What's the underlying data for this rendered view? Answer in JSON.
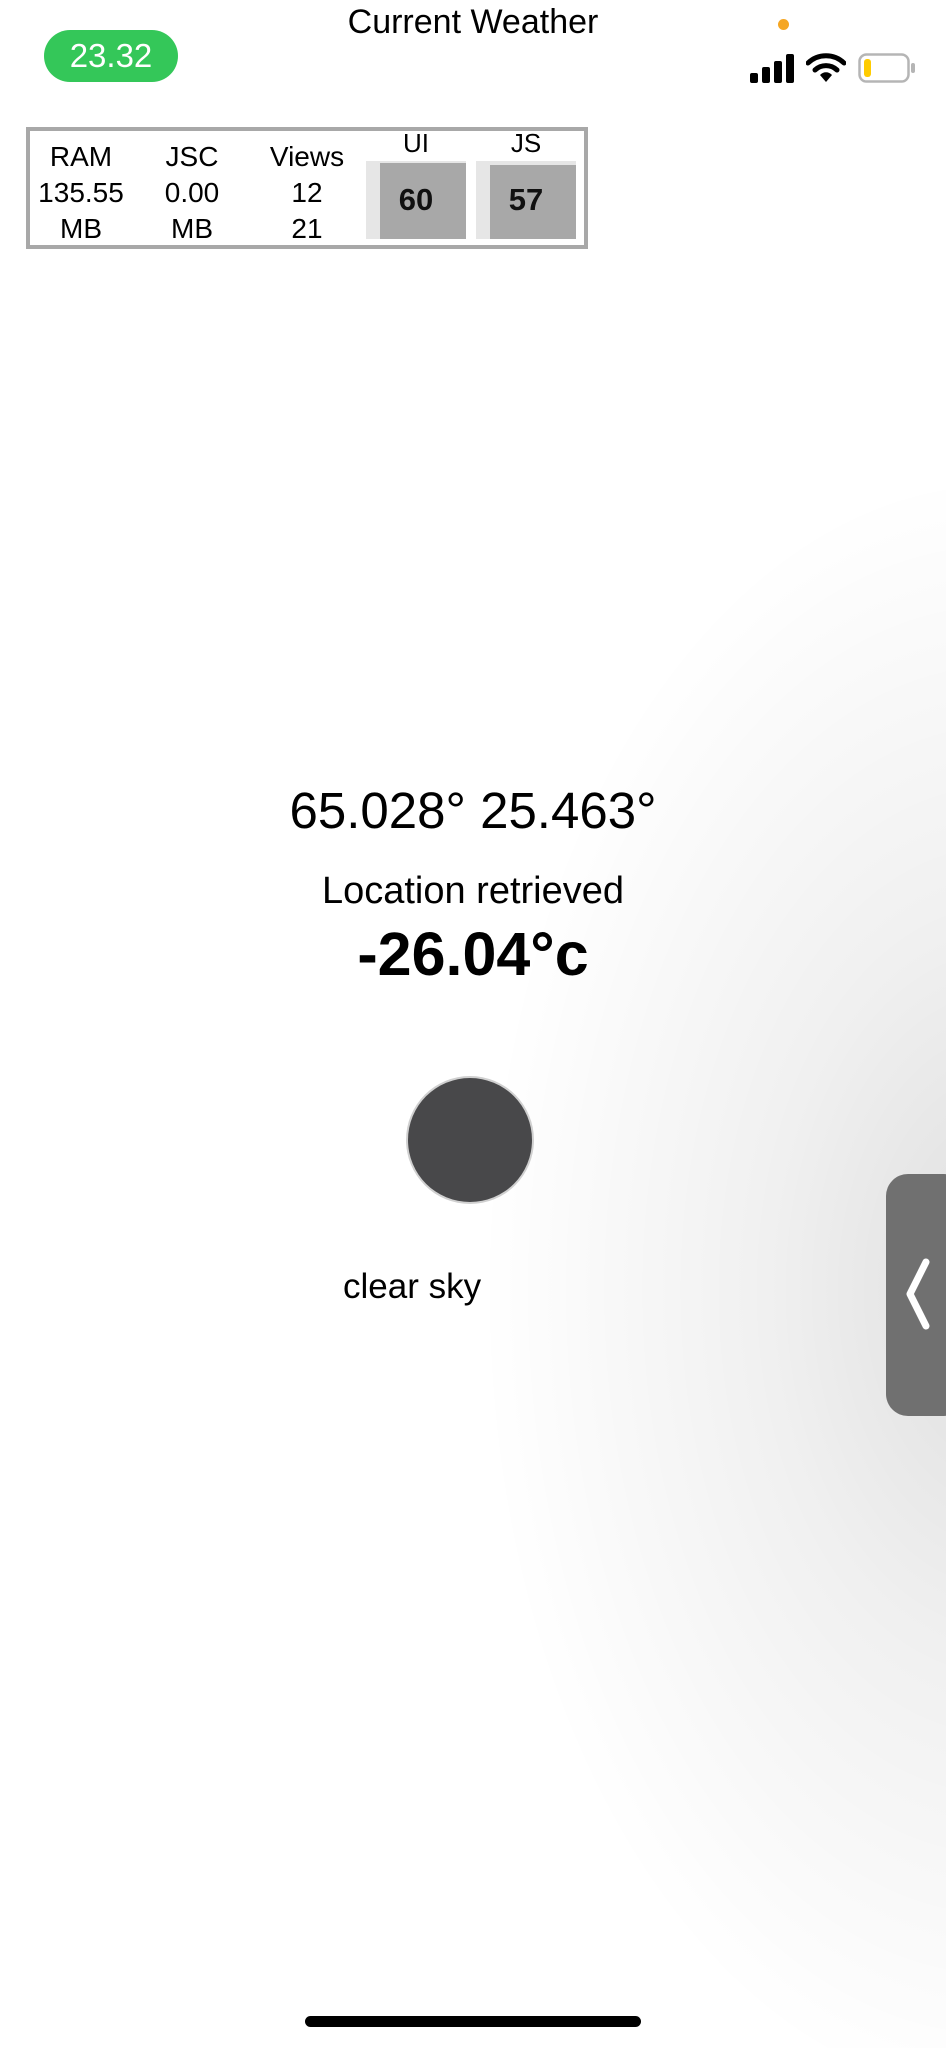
{
  "status_bar": {
    "time": "23.32",
    "title": "Current Weather",
    "icons": [
      "privacy-indicator-dot",
      "cellular-signal-icon",
      "wifi-icon",
      "battery-low-icon"
    ],
    "battery_level": 0.15,
    "colors": {
      "time_pill": "#34c759",
      "privacy_dot": "#f5a623",
      "battery_fill": "#ffcc00"
    }
  },
  "perf_monitor": {
    "ram": {
      "label": "RAM",
      "value": "135.55",
      "unit": "MB"
    },
    "jsc": {
      "label": "JSC",
      "value": "0.00",
      "unit": "MB"
    },
    "views": {
      "label": "Views",
      "value": "12",
      "value2": "21"
    },
    "ui": {
      "label": "UI",
      "fps": "60",
      "fill": 0.98
    },
    "js": {
      "label": "JS",
      "fps": "57",
      "fill": 0.95
    }
  },
  "weather": {
    "coordinates": "65.028° 25.463°",
    "status": "Location retrieved",
    "temperature": "-26.04°c",
    "icon": "weather-icon-placeholder",
    "description": "clear sky"
  },
  "side_handle": {
    "icon": "chevron-left-icon"
  }
}
